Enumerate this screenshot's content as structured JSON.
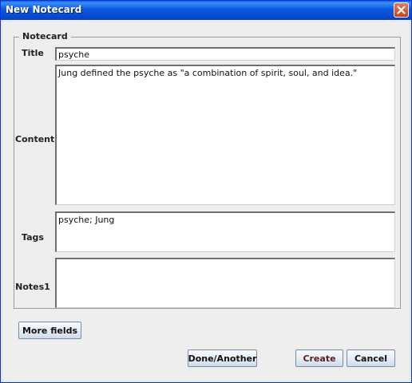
{
  "window": {
    "title": "New Notecard"
  },
  "group": {
    "legend": "Notecard"
  },
  "fields": {
    "title_label": "Title",
    "title_value": "psyche",
    "content_label": "Content",
    "content_value": "Jung defined the psyche as \"a combination of spirit, soul, and idea.\"",
    "tags_label": "Tags",
    "tags_value": "psyche; Jung",
    "notes_label": "Notes1",
    "notes_value": ""
  },
  "buttons": {
    "more_fields": "More fields",
    "done_another": "Done/Another",
    "create": "Create",
    "cancel": "Cancel"
  },
  "icons": {
    "close": "close-icon"
  }
}
